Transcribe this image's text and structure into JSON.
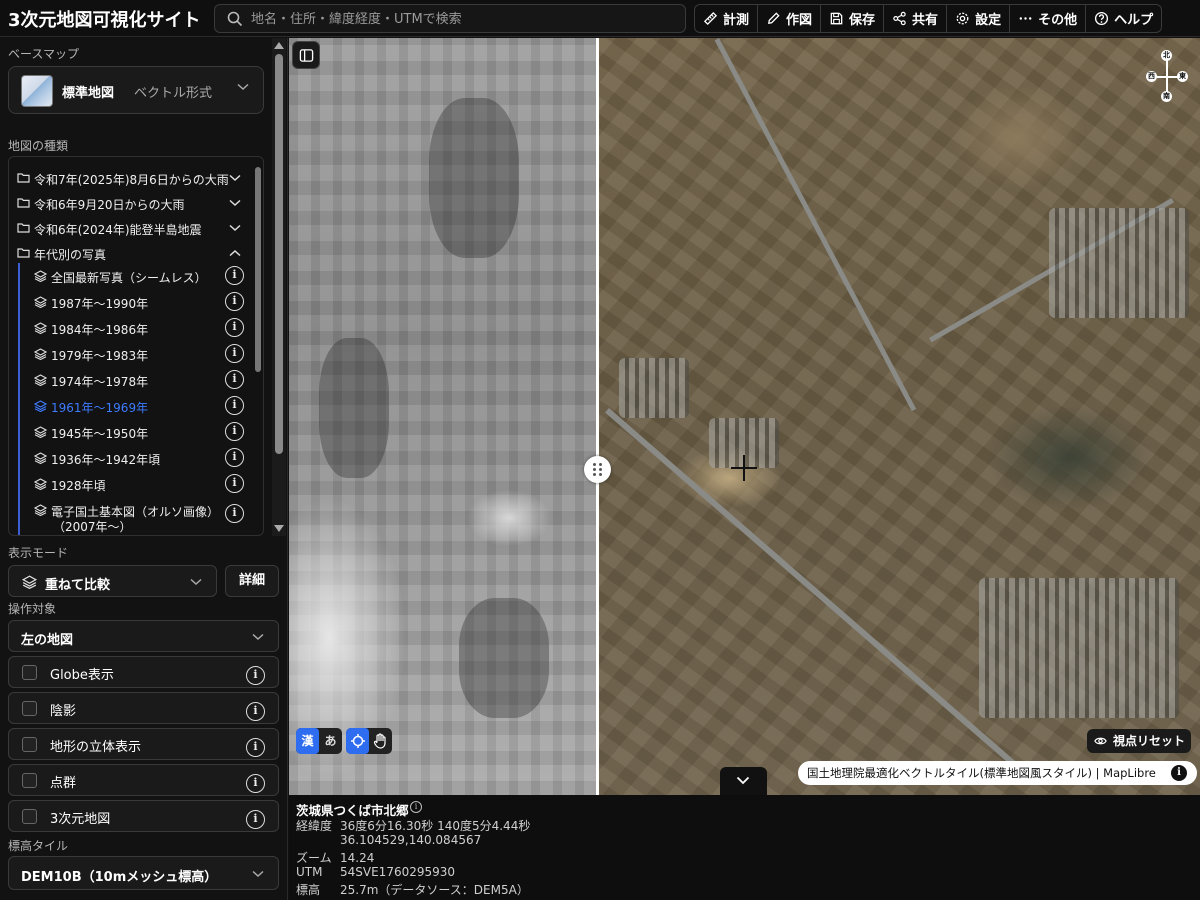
{
  "header": {
    "title": "3次元地図可視化サイト",
    "search_placeholder": "地名・住所・緯度経度・UTMで検索",
    "toolbar": [
      {
        "label": "計測",
        "icon": "ruler-icon"
      },
      {
        "label": "作図",
        "icon": "pencil-icon"
      },
      {
        "label": "保存",
        "icon": "save-icon"
      },
      {
        "label": "共有",
        "icon": "share-icon"
      },
      {
        "label": "設定",
        "icon": "gear-icon"
      },
      {
        "label": "その他",
        "icon": "more-icon"
      },
      {
        "label": "ヘルプ",
        "icon": "help-icon"
      }
    ]
  },
  "sidebar": {
    "basemap_label": "ベースマップ",
    "basemap": {
      "name": "標準地図",
      "type": "ベクトル形式"
    },
    "maptype_label": "地図の種類",
    "folders": [
      {
        "label": "令和7年(2025年)8月6日からの大雨",
        "expanded": false
      },
      {
        "label": "令和6年9月20日からの大雨",
        "expanded": false
      },
      {
        "label": "令和6年(2024年)能登半島地震",
        "expanded": false
      },
      {
        "label": "年代別の写真",
        "expanded": true
      }
    ],
    "photo_items": [
      {
        "label": "全国最新写真（シームレス）",
        "active": false
      },
      {
        "label": "1987年～1990年",
        "active": false
      },
      {
        "label": "1984年～1986年",
        "active": false
      },
      {
        "label": "1979年～1983年",
        "active": false
      },
      {
        "label": "1974年～1978年",
        "active": false
      },
      {
        "label": "1961年～1969年",
        "active": true
      },
      {
        "label": "1945年～1950年",
        "active": false
      },
      {
        "label": "1936年～1942年頃",
        "active": false
      },
      {
        "label": "1928年頃",
        "active": false
      },
      {
        "label": "電子国土基本図（オルソ画像）",
        "label2": "（2007年～）",
        "active": false
      }
    ],
    "display_mode_label": "表示モード",
    "display_mode": "重ねて比較",
    "detail_button": "詳細",
    "target_label": "操作対象",
    "target": "左の地図",
    "toggles": [
      {
        "label": "Globe表示",
        "checked": false
      },
      {
        "label": "陰影",
        "checked": false
      },
      {
        "label": "地形の立体表示",
        "checked": false
      },
      {
        "label": "点群",
        "checked": false
      },
      {
        "label": "3次元地図",
        "checked": false
      }
    ],
    "elevation_label": "標高タイル",
    "elevation": "DEM10B（10mメッシュ標高）"
  },
  "map": {
    "compass": {
      "n": "北",
      "s": "南",
      "w": "西",
      "e": "東"
    },
    "label_toggle": {
      "kanji": "漢",
      "kana": "あ"
    },
    "reset_view": "視点リセット",
    "attribution": "国土地理院最適化ベクトルタイル(標準地図風スタイル) | MapLibre",
    "colors": {
      "accent": "#2f6df0",
      "active_item": "#3d7bff"
    }
  },
  "info": {
    "location": "茨城県つくば市北郷",
    "rows": [
      {
        "key": "経緯度",
        "value": "36度6分16.30秒 140度5分4.44秒"
      },
      {
        "key": "",
        "value": "36.104529,140.084567"
      },
      {
        "key": "ズーム",
        "value": "14.24"
      },
      {
        "key": "UTM",
        "value": "54SVE1760295930"
      },
      {
        "key": "標高",
        "value": "25.7m（データソース：DEM5A）"
      }
    ]
  }
}
